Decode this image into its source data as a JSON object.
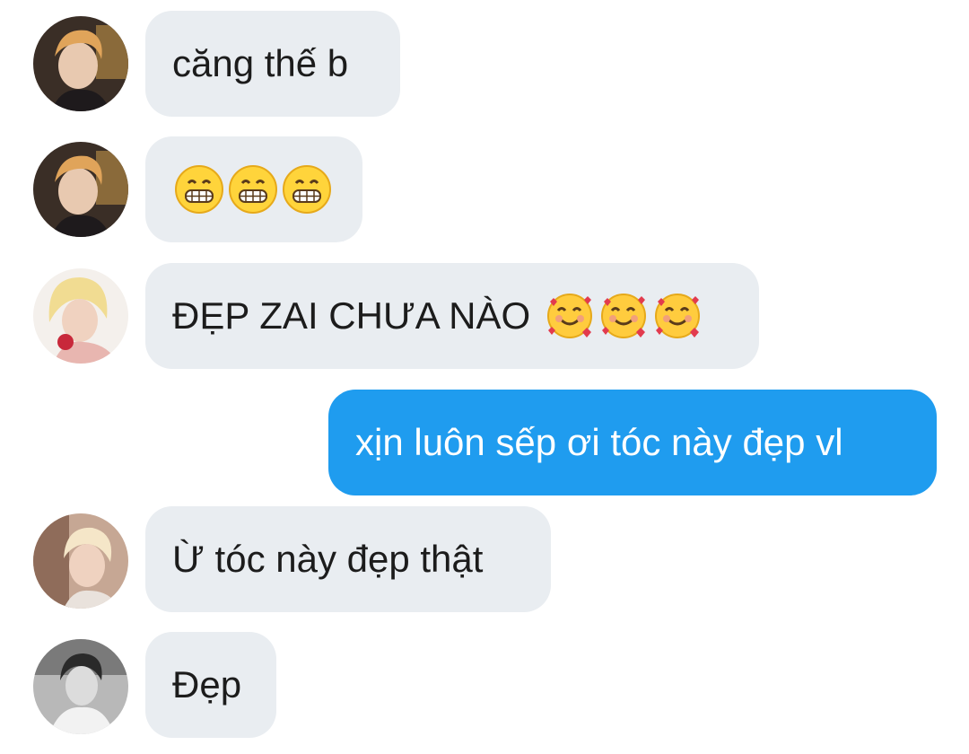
{
  "messages": [
    {
      "sender": "user-a",
      "text": "căng thế b"
    },
    {
      "sender": "user-a",
      "emojis": [
        "grinning-face",
        "grinning-face",
        "grinning-face"
      ]
    },
    {
      "sender": "user-b",
      "text": "ĐẸP ZAI CHƯA NÀO",
      "emojis": [
        "smiling-face-with-hearts",
        "smiling-face-with-hearts",
        "smiling-face-with-hearts"
      ]
    },
    {
      "sender": "me",
      "text": "xịn luôn sếp ơi tóc này đẹp vl"
    },
    {
      "sender": "user-c",
      "text": "Ừ tóc này đẹp thật"
    },
    {
      "sender": "user-d",
      "text": "Đẹp"
    }
  ],
  "colors": {
    "incoming_bubble": "#e9edf1",
    "outgoing_bubble": "#1f9cef",
    "text": "#1c1c1c",
    "outgoing_text": "#ffffff"
  }
}
